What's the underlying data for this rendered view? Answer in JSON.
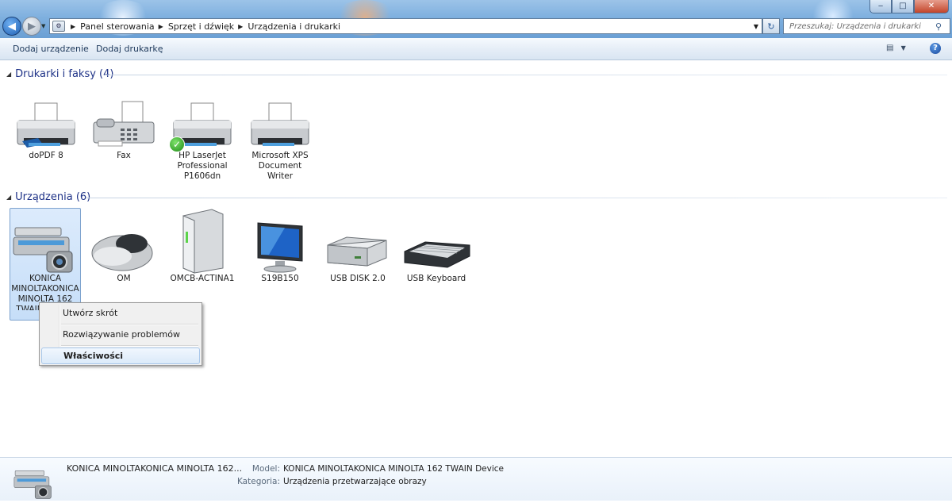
{
  "window": {
    "controls": {
      "minimize": "‒",
      "maximize": "□",
      "close": "✕"
    }
  },
  "nav": {
    "back_icon": "back-arrow-icon",
    "forward_icon": "forward-arrow-icon",
    "breadcrumb": [
      "Panel sterowania",
      "Sprzęt i dźwięk",
      "Urządzenia i drukarki"
    ],
    "search_placeholder": "Przeszukaj: Urządzenia i drukarki"
  },
  "toolbar": {
    "add_device": "Dodaj urządzenie",
    "add_printer": "Dodaj drukarkę"
  },
  "groups": {
    "printers": {
      "title": "Drukarki i faksy (4)",
      "items": [
        {
          "label": "doPDF 8",
          "icon": "printer-icon"
        },
        {
          "label": "Fax",
          "icon": "fax-icon"
        },
        {
          "label": "HP LaserJet Professional P1606dn",
          "icon": "printer-icon",
          "default": true
        },
        {
          "label": "Microsoft XPS Document Writer",
          "icon": "printer-icon"
        }
      ]
    },
    "devices": {
      "title": "Urządzenia (6)",
      "items": [
        {
          "label": "KONICA MINOLTAKONICA MINOLTA 162 TWAIN Device",
          "icon": "scanner-icon"
        },
        {
          "label": "OM",
          "icon": "mouse-icon"
        },
        {
          "label": "OMCB-ACTINA1",
          "icon": "computer-tower-icon"
        },
        {
          "label": "S19B150",
          "icon": "monitor-icon"
        },
        {
          "label": "USB DISK 2.0",
          "icon": "usb-drive-icon"
        },
        {
          "label": "USB Keyboard",
          "icon": "keyboard-icon"
        }
      ]
    }
  },
  "context_menu": {
    "items": [
      "Utwórz skrót",
      "Rozwiązywanie problemów",
      "Właściwości"
    ]
  },
  "details": {
    "name": "KONICA MINOLTAKONICA MINOLTA 162...",
    "model_label": "Model:",
    "model_value": "KONICA MINOLTAKONICA MINOLTA 162 TWAIN Device",
    "category_label": "Kategoria:",
    "category_value": "Urządzenia przetwarzające obrazy"
  },
  "colors": {
    "accent": "#1e3287",
    "selection": "#c6def8",
    "titlebar": "#7fb0df"
  }
}
